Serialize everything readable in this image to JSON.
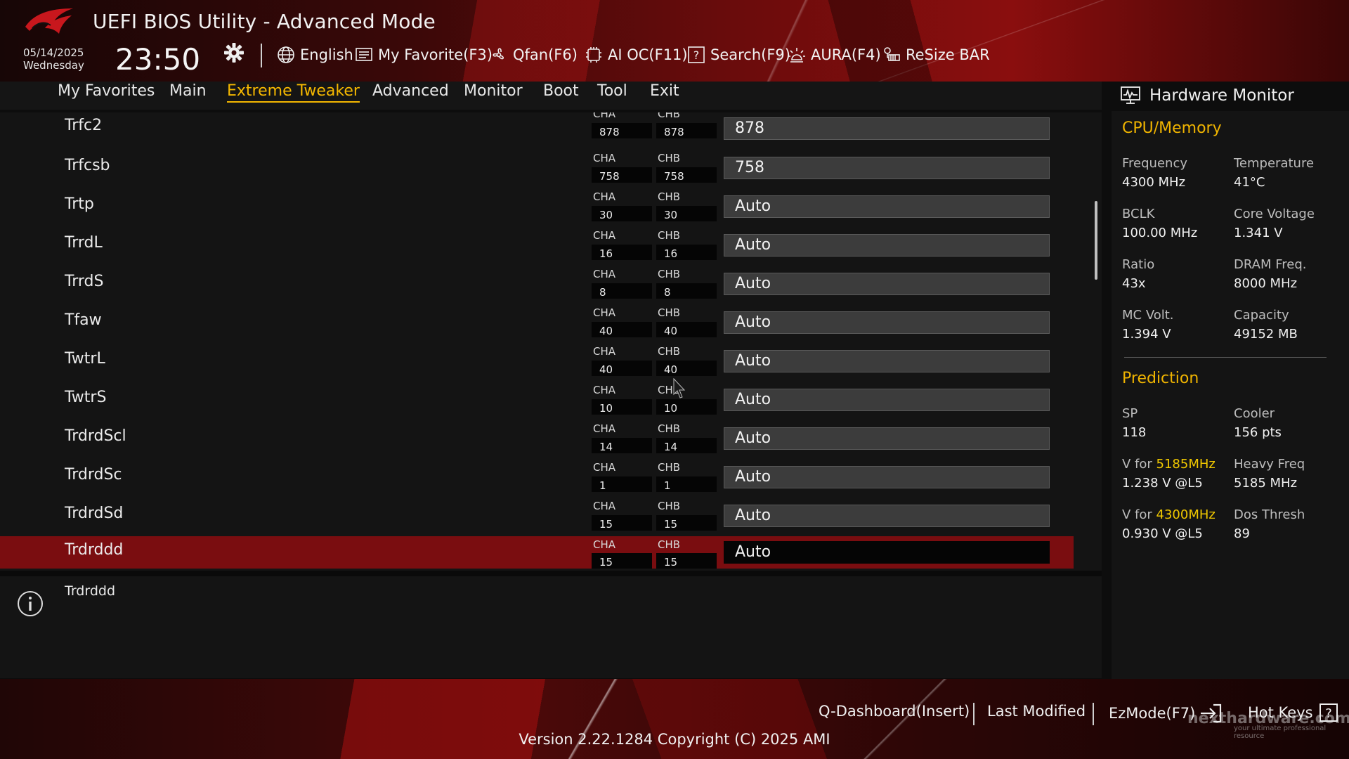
{
  "header": {
    "title": "UEFI BIOS Utility - Advanced Mode",
    "date": "05/14/2025",
    "day": "Wednesday",
    "time": "23:50",
    "toolbar": [
      {
        "label": "English",
        "icon": "globe-icon"
      },
      {
        "label": "My Favorite(F3)",
        "icon": "favorite-list-icon"
      },
      {
        "label": "Qfan(F6)",
        "icon": "fan-icon"
      },
      {
        "label": "AI OC(F11)",
        "icon": "ai-chip-icon"
      },
      {
        "label": "Search(F9)",
        "icon": "search-help-icon"
      },
      {
        "label": "AURA(F4)",
        "icon": "aura-light-icon"
      },
      {
        "label": "ReSize BAR",
        "icon": "resize-bar-icon"
      }
    ]
  },
  "nav": {
    "tabs": [
      "My Favorites",
      "Main",
      "Extreme Tweaker",
      "Advanced",
      "Monitor",
      "Boot",
      "Tool",
      "Exit"
    ],
    "active": "Extreme Tweaker"
  },
  "settings": {
    "rows": [
      {
        "label": "Trfc2",
        "cha_label": "CHA",
        "chb_label": "CHB",
        "cha": "878",
        "chb": "878",
        "value": "878"
      },
      {
        "label": "Trfcsb",
        "cha_label": "CHA",
        "chb_label": "CHB",
        "cha": "758",
        "chb": "758",
        "value": "758"
      },
      {
        "label": "Trtp",
        "cha_label": "CHA",
        "chb_label": "CHB",
        "cha": "30",
        "chb": "30",
        "value": "Auto"
      },
      {
        "label": "TrrdL",
        "cha_label": "CHA",
        "chb_label": "CHB",
        "cha": "16",
        "chb": "16",
        "value": "Auto"
      },
      {
        "label": "TrrdS",
        "cha_label": "CHA",
        "chb_label": "CHB",
        "cha": "8",
        "chb": "8",
        "value": "Auto"
      },
      {
        "label": "Tfaw",
        "cha_label": "CHA",
        "chb_label": "CHB",
        "cha": "40",
        "chb": "40",
        "value": "Auto"
      },
      {
        "label": "TwtrL",
        "cha_label": "CHA",
        "chb_label": "CHB",
        "cha": "40",
        "chb": "40",
        "value": "Auto"
      },
      {
        "label": "TwtrS",
        "cha_label": "CHA",
        "chb_label": "CHB",
        "cha": "10",
        "chb": "10",
        "value": "Auto"
      },
      {
        "label": "TrdrdScl",
        "cha_label": "CHA",
        "chb_label": "CHB",
        "cha": "14",
        "chb": "14",
        "value": "Auto"
      },
      {
        "label": "TrdrdSc",
        "cha_label": "CHA",
        "chb_label": "CHB",
        "cha": "1",
        "chb": "1",
        "value": "Auto"
      },
      {
        "label": "TrdrdSd",
        "cha_label": "CHA",
        "chb_label": "CHB",
        "cha": "15",
        "chb": "15",
        "value": "Auto"
      },
      {
        "label": "Trdrddd",
        "cha_label": "CHA",
        "chb_label": "CHB",
        "cha": "15",
        "chb": "15",
        "value": "Auto",
        "selected": true
      }
    ]
  },
  "info": {
    "text": "Trdrddd"
  },
  "hardware_monitor": {
    "title": "Hardware Monitor",
    "cpu_memory": {
      "title": "CPU/Memory",
      "frequency_label": "Frequency",
      "frequency": "4300 MHz",
      "temperature_label": "Temperature",
      "temperature": "41°C",
      "bclk_label": "BCLK",
      "bclk": "100.00 MHz",
      "core_voltage_label": "Core Voltage",
      "core_voltage": "1.341 V",
      "ratio_label": "Ratio",
      "ratio": "43x",
      "dram_freq_label": "DRAM Freq.",
      "dram_freq": "8000 MHz",
      "mc_volt_label": "MC Volt.",
      "mc_volt": "1.394 V",
      "capacity_label": "Capacity",
      "capacity": "49152 MB"
    },
    "prediction": {
      "title": "Prediction",
      "sp_label": "SP",
      "sp": "118",
      "cooler_label": "Cooler",
      "cooler": "156 pts",
      "v_for_prefix": "V for",
      "v1_freq": "5185MHz",
      "v1_value": "1.238 V @L5",
      "heavy_freq_label": "Heavy Freq",
      "heavy_freq": "5185 MHz",
      "v2_freq": "4300MHz",
      "v2_value": "0.930 V @L5",
      "dos_thresh_label": "Dos Thresh",
      "dos_thresh": "89"
    }
  },
  "footer": {
    "q_dashboard": "Q-Dashboard(Insert)",
    "last_modified": "Last Modified",
    "ezmode": "EzMode(F7)",
    "hot_keys": "Hot Keys",
    "version": "Version 2.22.1284 Copyright (C) 2025 AMI",
    "watermark": "nexthardware.com",
    "watermark_tagline": "your ultimate professional resource"
  },
  "colors": {
    "accent": "#f0b400",
    "selected_row": "#7a0d10",
    "highlight": "#f0c800"
  }
}
